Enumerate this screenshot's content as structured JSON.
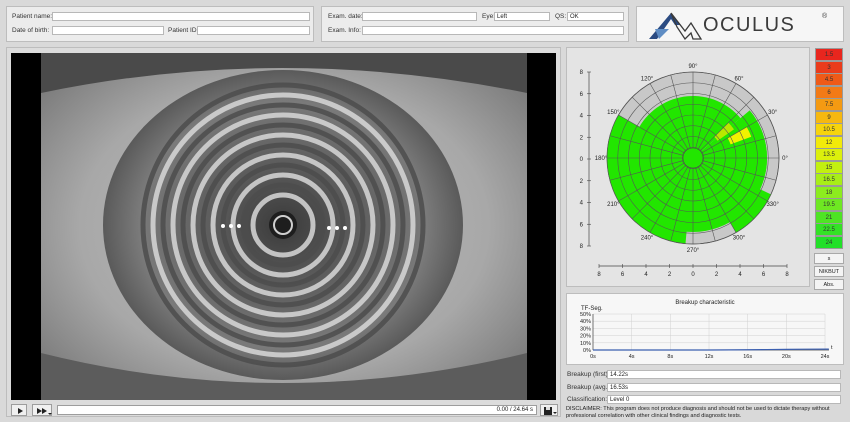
{
  "patient": {
    "name_label": "Patient name:",
    "name_value": "",
    "dob_label": "Date of birth:",
    "dob_value": "",
    "id_label": "Patient ID:",
    "id_value": ""
  },
  "exam": {
    "date_label": "Exam. date:",
    "date_value": "",
    "eye_label": "Eye:",
    "eye_value": "Left",
    "qs_label": "QS:",
    "qs_value": "OK",
    "info_label": "Exam. Info:",
    "info_value": ""
  },
  "logo": {
    "text": "OCULUS",
    "mark": "®"
  },
  "player": {
    "time_readout": "0.00 / 24.64 s",
    "play_icon": "play-icon",
    "speed_icon": "speed-icon",
    "save_icon": "save-icon"
  },
  "polar_map": {
    "angle_labels": [
      "0°",
      "30°",
      "60°",
      "90°",
      "120°",
      "150°",
      "180°",
      "210°",
      "240°",
      "270°",
      "300°",
      "330°"
    ],
    "axis_ticks": [
      "8",
      "6",
      "4",
      "2",
      "0",
      "2",
      "4",
      "6",
      "8"
    ],
    "fill_colors": {
      "green": "#22e600",
      "yellow": "#f2f200",
      "yellow_green": "#b9e800",
      "gray": "#c8c8c8"
    }
  },
  "scale": {
    "values": [
      "1.5",
      "3",
      "4.5",
      "6",
      "7.5",
      "9",
      "10.5",
      "12",
      "13.5",
      "15",
      "16.5",
      "18",
      "19.5",
      "21",
      "22.5",
      "24"
    ],
    "colors": [
      "#e8261e",
      "#ea3c1c",
      "#ef5a18",
      "#f27a16",
      "#f49a12",
      "#f6b810",
      "#f6d40c",
      "#f2ea0a",
      "#dcf00c",
      "#c2f010",
      "#a8ee18",
      "#8cec1e",
      "#6ee822",
      "#4ee424",
      "#34e226",
      "#22e028"
    ],
    "unit_button": "s",
    "nikbut_button": "NIKBUT",
    "abs_button": "Abs."
  },
  "breakup_chart": {
    "title": "Breakup characteristic",
    "ylabel": "TF-Seg.",
    "y_ticks": [
      "50%",
      "40%",
      "30%",
      "20%",
      "10%",
      "0%"
    ],
    "x_ticks": [
      "0s",
      "4s",
      "8s",
      "12s",
      "16s",
      "20s",
      "24s"
    ],
    "x_axis_suffix": "t"
  },
  "chart_data": {
    "type": "line",
    "title": "Breakup characteristic",
    "ylabel": "TF-Seg.",
    "xlabel": "t",
    "x": [
      0,
      4,
      8,
      12,
      14.2,
      16,
      18,
      20,
      22,
      24.6
    ],
    "values": [
      0,
      0,
      0,
      0,
      0.2,
      0.3,
      0.6,
      0.9,
      1.1,
      1.2
    ],
    "xlim": [
      0,
      24
    ],
    "ylim": [
      0,
      50
    ],
    "grid": true
  },
  "results": {
    "first_label": "Breakup (first):",
    "first_value": "14.22s",
    "avg_label": "Breakup (avg.):",
    "avg_value": "16.53s",
    "class_label": "Classification:",
    "class_value": "Level 0"
  },
  "disclaimer": "DISCLAIMER: This program does not produce diagnosis and should not be used to dictate therapy without professional correlation with other clinical findings and diagnostic tests."
}
